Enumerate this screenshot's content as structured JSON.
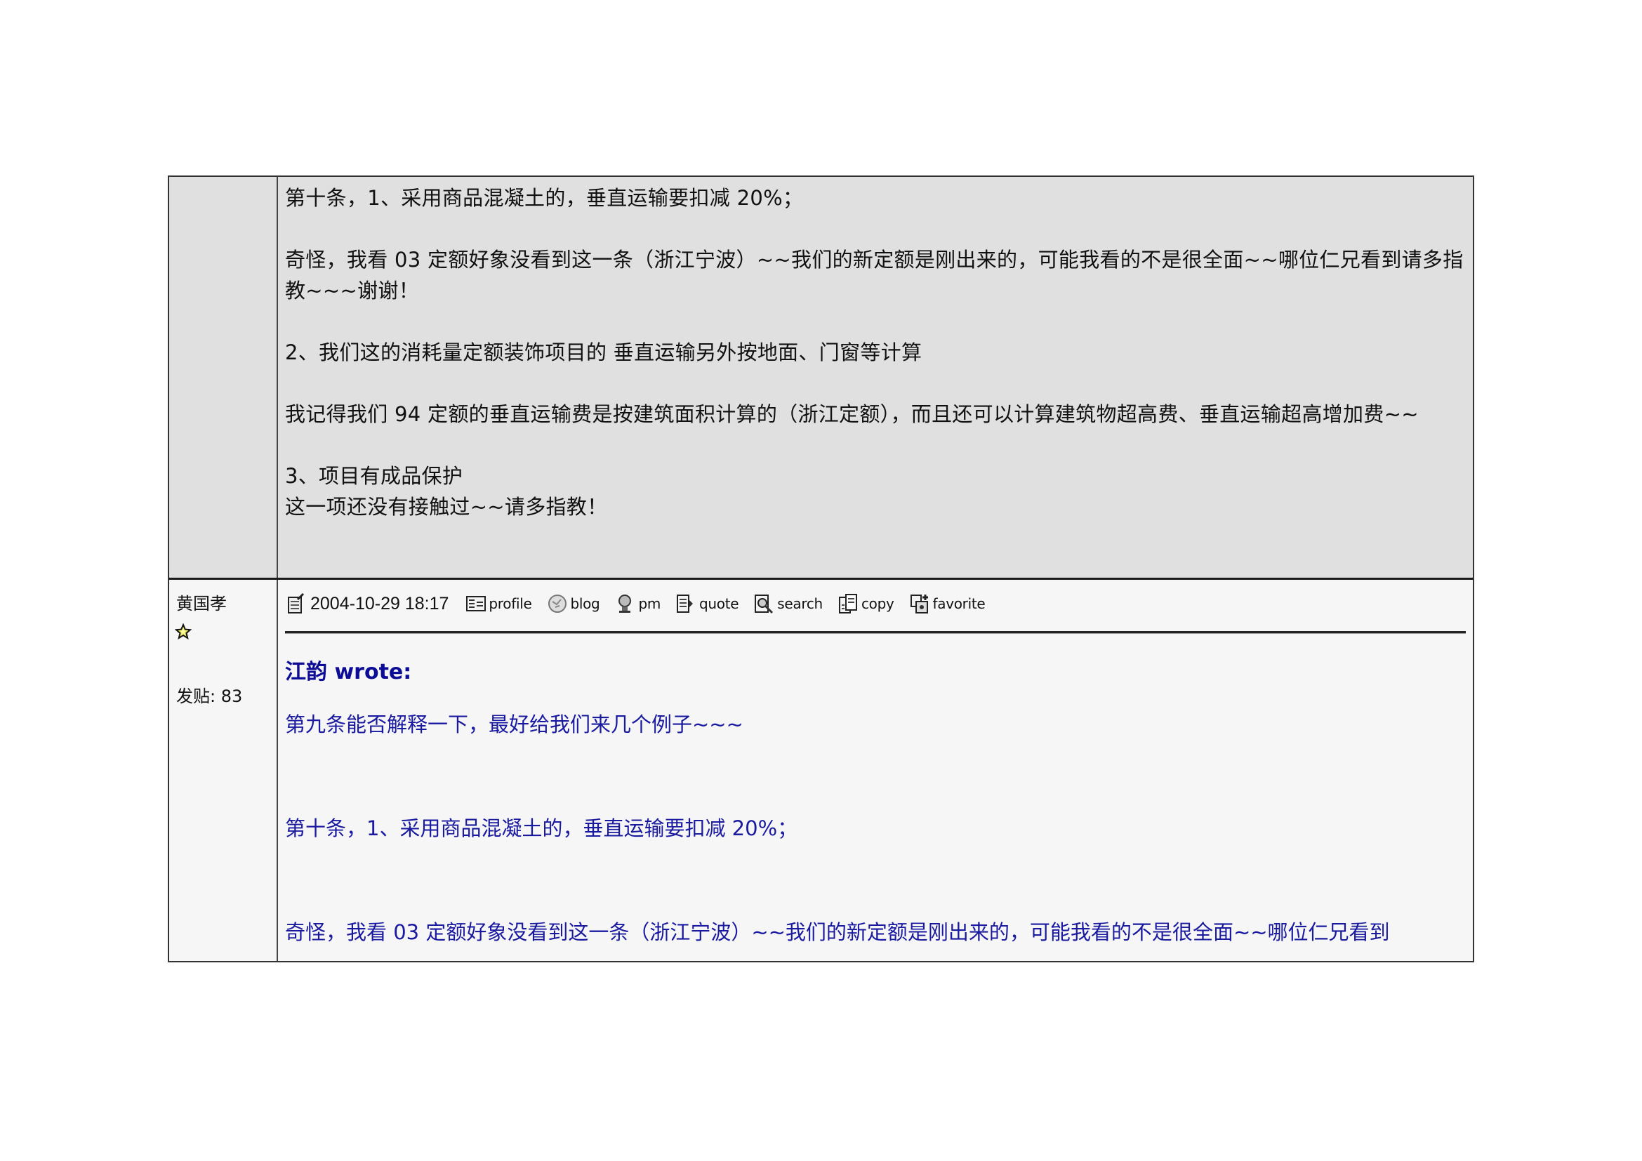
{
  "post1": {
    "paragraphs": [
      "第十条，1、采用商品混凝土的，垂直运输要扣减 20%；",
      "",
      "奇怪，我看 03 定额好象没看到这一条（浙江宁波）~~我们的新定额是刚出来的，可能我看的不是很全面~~哪位仁兄看到请多指教~~~谢谢！",
      "",
      "2、我们这的消耗量定额装饰项目的  垂直运输另外按地面、门窗等计算",
      "",
      "我记得我们 94 定额的垂直运输费是按建筑面积计算的（浙江定额），而且还可以计算建筑物超高费、垂直运输超高增加费~~",
      "",
      "3、项目有成品保护",
      "这一项还没有接触过~~请多指教！"
    ]
  },
  "post2": {
    "author": {
      "name": "黄国孝",
      "rank_icon": "star-icon",
      "posts_label": "发贴: 83"
    },
    "toolbar": {
      "post_icon": "post-edit-icon",
      "date": "2004-10-29 18:17",
      "buttons": [
        {
          "label": "profile",
          "icon": "profile-icon"
        },
        {
          "label": "blog",
          "icon": "blog-icon"
        },
        {
          "label": "pm",
          "icon": "pm-icon"
        },
        {
          "label": "quote",
          "icon": "quote-icon"
        },
        {
          "label": "search",
          "icon": "search-icon"
        },
        {
          "label": "copy",
          "icon": "copy-icon"
        },
        {
          "label": "favorite",
          "icon": "favorite-icon"
        }
      ]
    },
    "quote": {
      "header": "江韵  wrote:",
      "lines": [
        "第九条能否解释一下，最好给我们来几个例子~~~",
        "第十条，1、采用商品混凝土的，垂直运输要扣减 20%；",
        "奇怪，我看 03 定额好象没看到这一条（浙江宁波）~~我们的新定额是刚出来的，可能我看的不是很全面~~哪位仁兄看到"
      ]
    }
  },
  "colors": {
    "row1_bg": "#e0e0e0",
    "row2_bg": "#f6f6f6",
    "quote_text": "#1a1aa0",
    "border": "#333333"
  }
}
